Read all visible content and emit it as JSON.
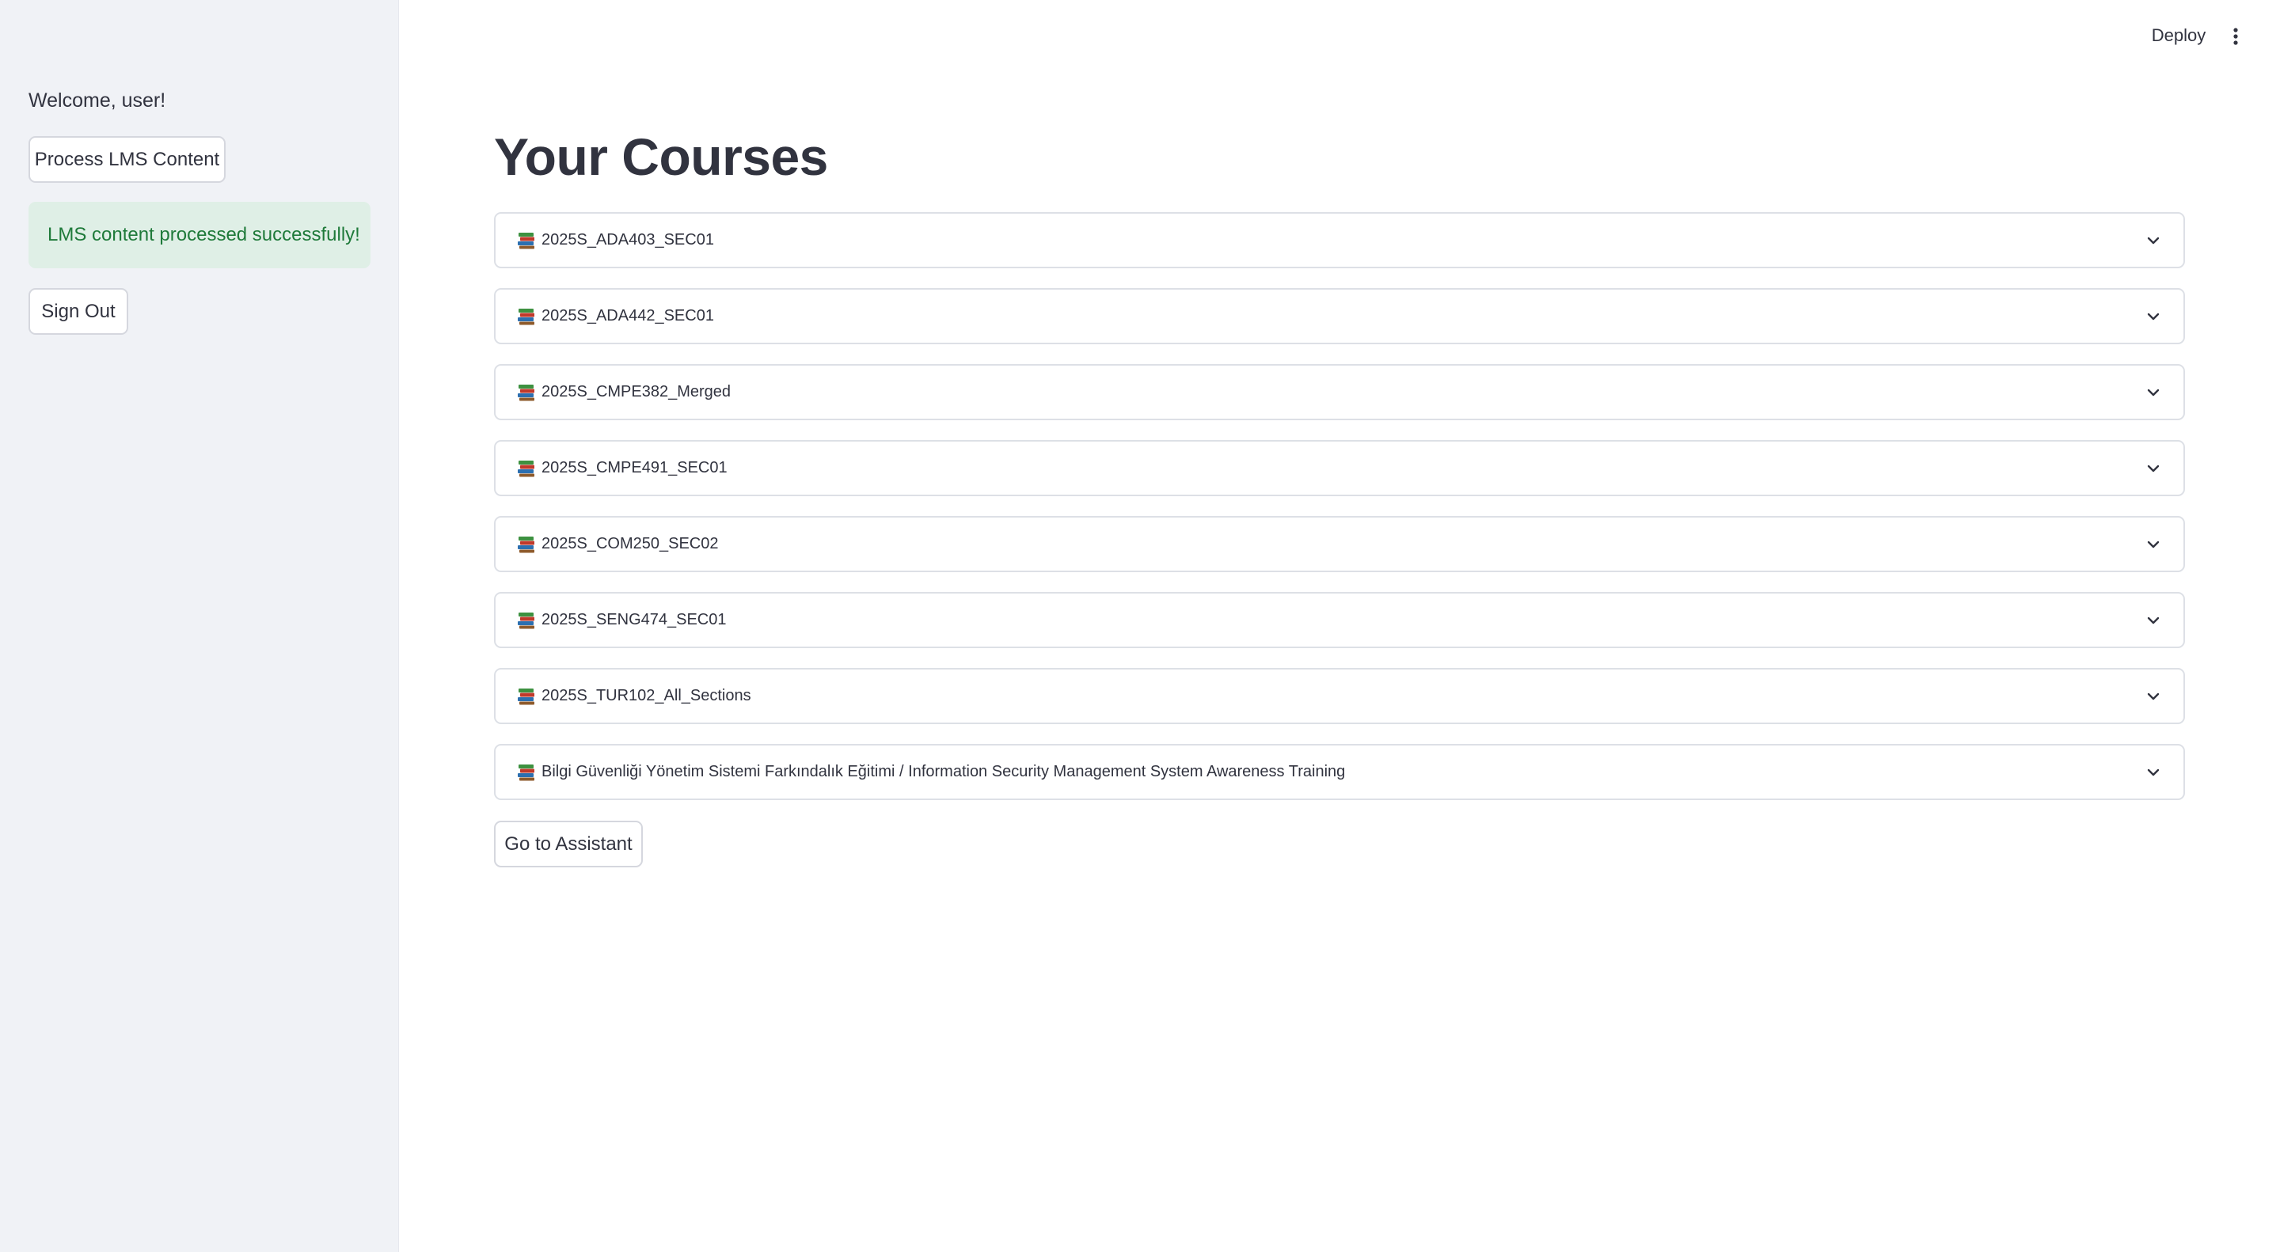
{
  "sidebar": {
    "welcome": "Welcome, user!",
    "process_label": "Process LMS Content",
    "success_message": "LMS content processed successfully!",
    "signout_label": "Sign Out"
  },
  "header": {
    "deploy_label": "Deploy",
    "menu_icon": "vertical-dots-icon"
  },
  "main": {
    "title": "Your Courses",
    "course_icon": "books-icon",
    "courses": [
      "2025S_ADA403_SEC01",
      "2025S_ADA442_SEC01",
      "2025S_CMPE382_Merged",
      "2025S_CMPE491_SEC01",
      "2025S_COM250_SEC02",
      "2025S_SENG474_SEC01",
      "2025S_TUR102_All_Sections",
      "Bilgi Güvenliği Yönetim Sistemi Farkındalık Eğitimi / Information Security Management System Awareness Training"
    ],
    "assistant_label": "Go to Assistant"
  },
  "colors": {
    "sidebar_bg": "#f0f2f6",
    "success_bg": "#dfefe6",
    "success_text": "#1f7a3a",
    "text": "#31333f"
  }
}
